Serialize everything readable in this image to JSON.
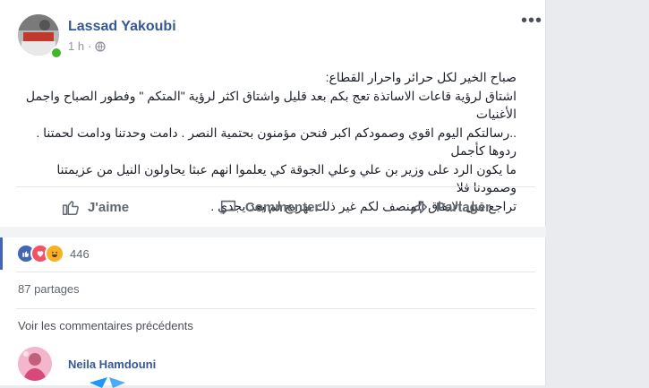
{
  "post": {
    "author": "Lassad Yakoubi",
    "time": "1 h",
    "separator": "·",
    "text_lines": [
      "صباح الخير لكل حرائر واحرار القطاع:",
      "اشتاق لرؤية قاعات الاساتذة تعج بكم بعد قليل واشتاق اكثر لرؤية \"المتكم \" وفطور الصباح واجمل الأغنيات",
      "..رسالتكم اليوم اقوي وصمودكم اكبر فنحن مؤمنون بحتمية النصر . دامت وحدتنا ودامت لحمتنا . ردوها كأجمل",
      "ما يكون الرد على وزير بن علي وعلي الجوقة كي يعلموا انهم عبثا يحاولون النيل من عزيمتنا وصمودنا فلا",
      "تراجع قبل الاتفاق المنصف لكم غير ذلك تهريج لم يعد يجدي ."
    ],
    "more_icon": "more-options-icon",
    "privacy_icon": "globe-icon"
  },
  "actions": {
    "like": "J'aime",
    "comment": "Commenter",
    "share": "Partager"
  },
  "reactions": {
    "icons": [
      "like-reaction-icon",
      "love-reaction-icon",
      "haha-reaction-icon"
    ],
    "count": "446"
  },
  "shares": "87 partages",
  "previous_comments": "Voir les commentaires précédents",
  "comment": {
    "author": "Neila Hamdouni"
  },
  "colors": {
    "link_blue": "#365899",
    "fb_blue": "#4267b2",
    "love_red": "#f25268",
    "haha_yellow": "#f7b125",
    "online_green": "#42b72a"
  }
}
